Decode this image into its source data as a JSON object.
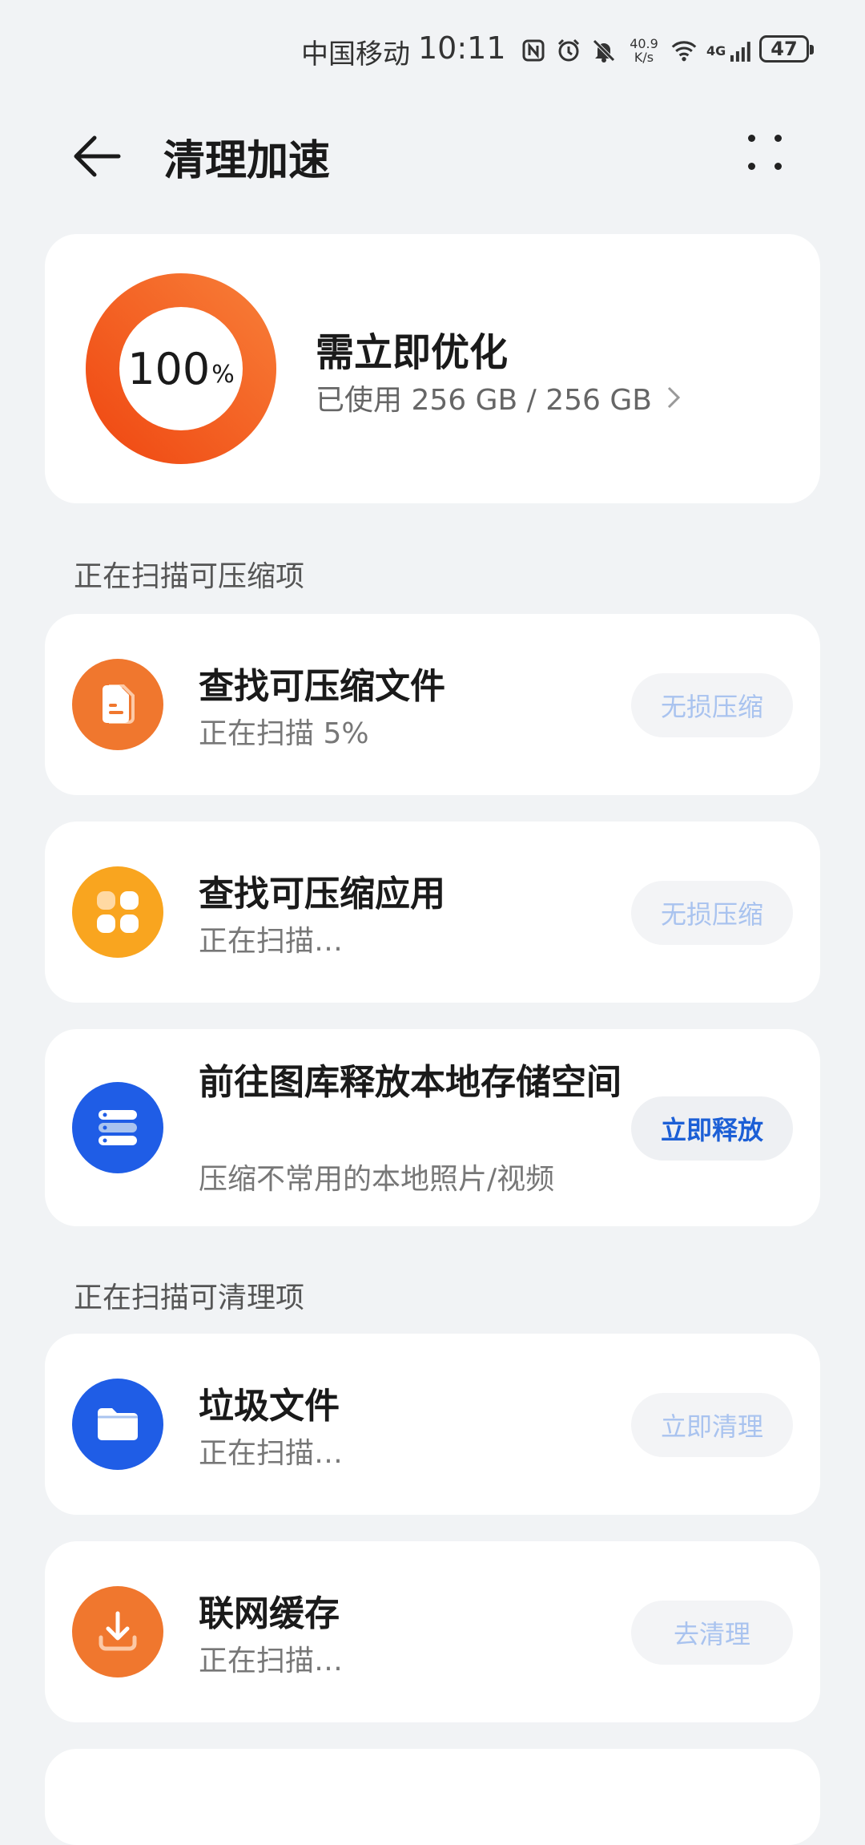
{
  "status_bar": {
    "carrier": "中国移动",
    "time": "10:11",
    "net_speed_value": "40.9",
    "net_speed_unit": "K/s",
    "network": "4G",
    "battery": "47"
  },
  "header": {
    "title": "清理加速"
  },
  "storage": {
    "percent": "100",
    "percent_unit": "%",
    "percent_value": 100,
    "status": "需立即优化",
    "usage": "已使用 256 GB / 256 GB",
    "ring_color_start": "#f04b14",
    "ring_color_end": "#f77a35"
  },
  "sections": {
    "compress": "正在扫描可压缩项",
    "clean": "正在扫描可清理项"
  },
  "items": [
    {
      "title": "查找可压缩文件",
      "subtitle": "正在扫描 5%",
      "button": "无损压缩",
      "icon": "document-icon",
      "color": "#f0772e"
    },
    {
      "title": "查找可压缩应用",
      "subtitle": "正在扫描…",
      "button": "无损压缩",
      "icon": "apps-grid-icon",
      "color": "#f9a51f"
    },
    {
      "title": "前往图库释放本地存储空间",
      "subtitle": "压缩不常用的本地照片/视频",
      "button": "立即释放",
      "icon": "storage-stack-icon",
      "color": "#1f5de6"
    },
    {
      "title": "垃圾文件",
      "subtitle": "正在扫描…",
      "button": "立即清理",
      "icon": "folder-icon",
      "color": "#1f5de6"
    },
    {
      "title": "联网缓存",
      "subtitle": "正在扫描…",
      "button": "去清理",
      "icon": "download-icon",
      "color": "#f0772e"
    }
  ]
}
